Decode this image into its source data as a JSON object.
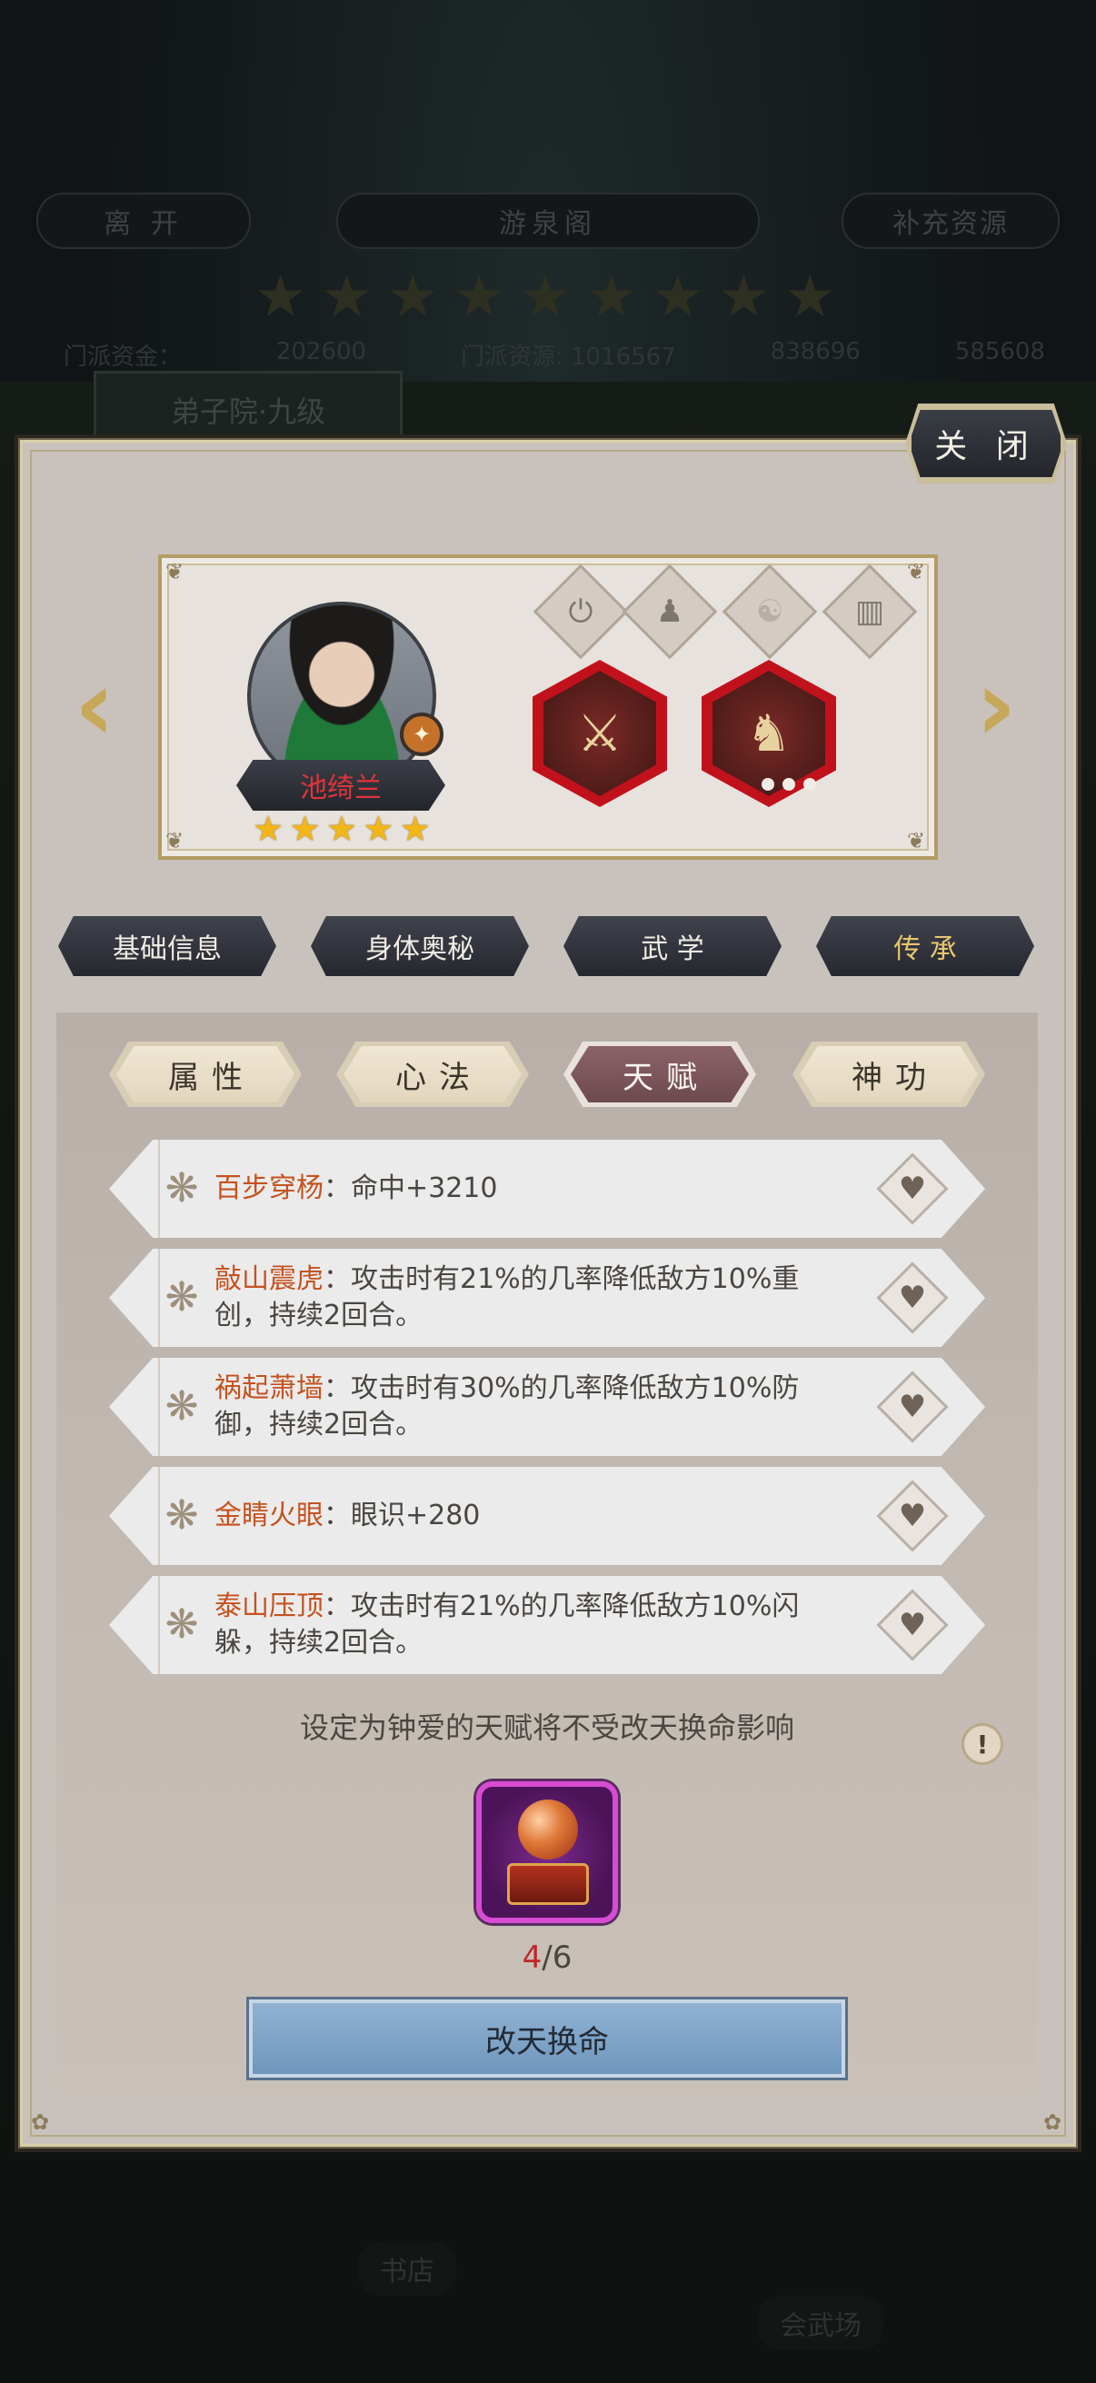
{
  "background": {
    "leave_label": "离 开",
    "location_title": "游泉阁",
    "replenish_label": "补充资源",
    "stars": [
      "★",
      "★",
      "★",
      "★",
      "★",
      "★",
      "★",
      "★",
      "★"
    ],
    "funds_label": "门派资金：",
    "funds_value": "202600",
    "resources_label": "门派资源: 1016567",
    "res2": "838696",
    "res3": "585608",
    "building_plaque": "弟子院·九级",
    "bookstore_label": "书店",
    "arena_label": "会武场"
  },
  "panel": {
    "close_label": "关 闭",
    "character": {
      "name": "池绮兰",
      "stars": [
        "★",
        "★",
        "★",
        "★",
        "★"
      ],
      "badge_icon": "sect-badge-icon",
      "equip_icons": [
        "timer-icon",
        "person-icon",
        "yin-yang-icon",
        "book-icon"
      ],
      "items": [
        {
          "icon": "weapon-icon",
          "glyph": "⚔"
        },
        {
          "icon": "horse-icon",
          "glyph": "♞"
        }
      ]
    },
    "main_tabs": [
      {
        "label": "基础信息"
      },
      {
        "label": "身体奥秘"
      },
      {
        "label": "武 学"
      },
      {
        "label": "传 承"
      }
    ],
    "main_tab_active": 3,
    "sub_tabs": [
      {
        "label": "属性"
      },
      {
        "label": "心法"
      },
      {
        "label": "天赋"
      },
      {
        "label": "神功"
      }
    ],
    "sub_tab_active": 2,
    "talents": [
      {
        "name": "百步穿杨",
        "sep": "：",
        "desc": "命中+3210"
      },
      {
        "name": "敲山震虎",
        "sep": "：",
        "desc": "攻击时有21%的几率降低敌方10%重创，持续2回合。"
      },
      {
        "name": "祸起萧墙",
        "sep": "：",
        "desc": "攻击时有30%的几率降低敌方10%防御，持续2回合。"
      },
      {
        "name": "金睛火眼",
        "sep": "：",
        "desc": "眼识+280"
      },
      {
        "name": "泰山压顶",
        "sep": "：",
        "desc": "攻击时有21%的几率降低敌方10%闪躲，持续2回合。"
      }
    ],
    "notice": "设定为钟爱的天赋将不受改天换命影响",
    "info_glyph": "!",
    "count_current": "4",
    "count_sep": "/",
    "count_total": "6",
    "change_button": "改天换命"
  }
}
